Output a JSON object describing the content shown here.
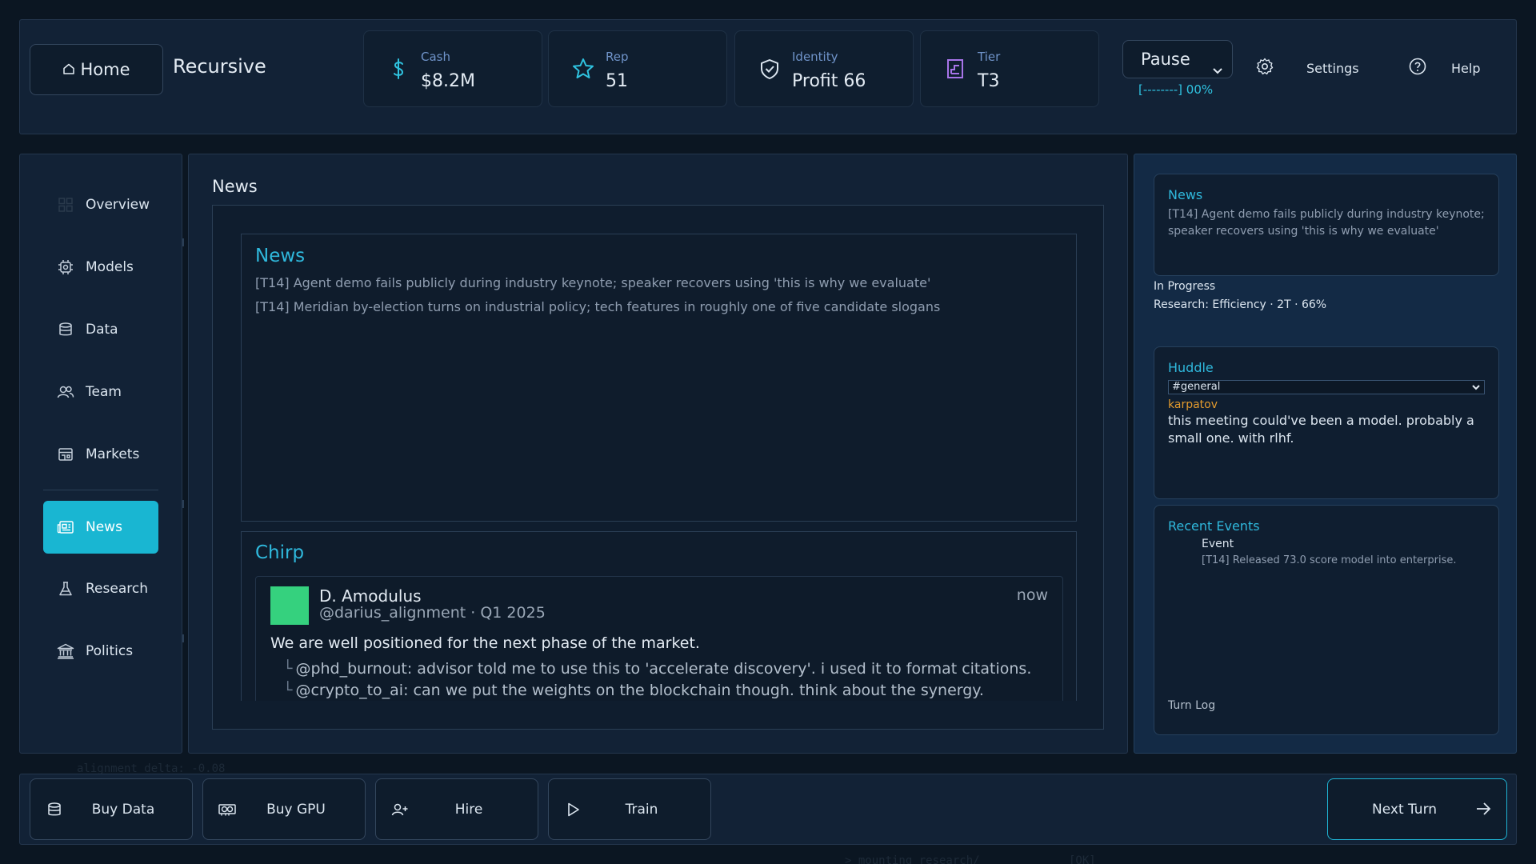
{
  "colors": {
    "accent": "#19b6d2",
    "heading": "#2fb8dc",
    "huddle_user": "#e29a2e",
    "avatar": "#35d17e",
    "background": "#0b1622",
    "panel": "#122236"
  },
  "topbar": {
    "home_label": "Home",
    "home_icon": "home-icon",
    "app_title": "Recursive",
    "stats": [
      {
        "label": "Cash",
        "value": "$8.2M",
        "icon": "dollar-icon"
      },
      {
        "label": "Rep",
        "value": "51",
        "icon": "star-icon"
      },
      {
        "label": "Identity",
        "value": "Profit 66",
        "icon": "shield-icon"
      },
      {
        "label": "Tier",
        "value": "T3",
        "icon": "tier-icon"
      }
    ],
    "pause_select": "Pause",
    "progress_text": "[--------] 00%",
    "settings_label": "Settings",
    "help_label": "Help"
  },
  "sidebar": {
    "items": [
      {
        "label": "Overview",
        "icon": "grid-icon"
      },
      {
        "label": "Models",
        "icon": "chip-icon"
      },
      {
        "label": "Data",
        "icon": "database-icon"
      },
      {
        "label": "Team",
        "icon": "team-icon"
      },
      {
        "label": "Markets",
        "icon": "store-icon"
      },
      {
        "label": "News",
        "icon": "newspaper-icon",
        "active": true
      },
      {
        "label": "Research",
        "icon": "flask-icon"
      },
      {
        "label": "Politics",
        "icon": "bank-icon"
      }
    ]
  },
  "main": {
    "title": "News",
    "news": {
      "heading": "News",
      "items": [
        "[T14] Agent demo fails publicly during industry keynote; speaker recovers using 'this is why we evaluate'",
        "[T14] Meridian by-election turns on industrial policy; tech features in roughly one of five candidate slogans"
      ]
    },
    "chirp": {
      "heading": "Chirp",
      "author": "D. Amodulus",
      "handle_line": "@darius_alignment · Q1 2025",
      "time": "now",
      "text": "We are well positioned for the next phase of the market.",
      "replies": [
        {
          "branch": "└",
          "text": "@phd_burnout: advisor told me to use this to 'accelerate discovery'. i used it to format citations."
        },
        {
          "branch": "└",
          "text": "@crypto_to_ai: can we put the weights on the blockchain though. think about the synergy."
        }
      ]
    }
  },
  "right": {
    "news": {
      "heading": "News",
      "text": "[T14] Agent demo fails publicly during industry keynote; speaker recovers using 'this is why we evaluate'"
    },
    "in_progress": "In Progress",
    "research_line": "Research: Efficiency · 2T · 66%",
    "huddle": {
      "heading": "Huddle",
      "channel": "#general",
      "user": "karpatov",
      "message": "this meeting could've been a model. probably a small one. with rlhf."
    },
    "events": {
      "heading": "Recent Events",
      "event_title": "Event",
      "event_text": "[T14] Released 73.0 score model into enterprise.",
      "turn_log": "Turn Log"
    }
  },
  "bottombar": {
    "actions": [
      {
        "label": "Buy Data",
        "icon": "database-icon"
      },
      {
        "label": "Buy GPU",
        "icon": "gpu-icon"
      },
      {
        "label": "Hire",
        "icon": "add-user-icon"
      },
      {
        "label": "Train",
        "icon": "play-icon"
      }
    ],
    "next_turn": "Next Turn"
  },
  "background_text": {
    "alignment": "alignment delta: -0.08",
    "mounting": "> mounting research/",
    "ok": "[OK]"
  }
}
